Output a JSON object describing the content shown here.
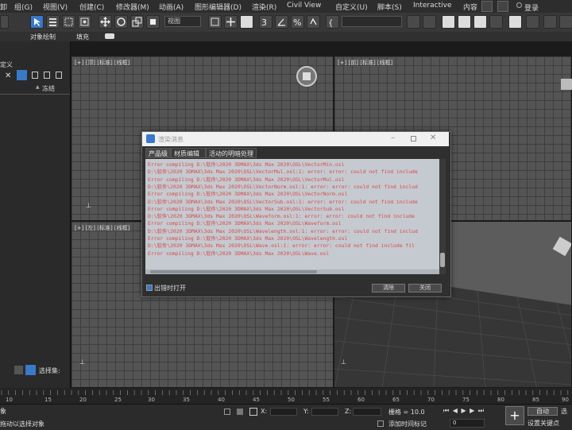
{
  "menubar": {
    "items": [
      "组(G)",
      "视图(V)",
      "创建(C)",
      "修改器(M)",
      "动画(A)",
      "图形编辑器(D)",
      "渲染(R)",
      "Civil View",
      "自定义(U)",
      "脚本(S)",
      "Interactive",
      "内容"
    ],
    "login": "登录",
    "left_fragment": "卸"
  },
  "toolbar": {
    "view_select": "视图"
  },
  "ribbon": {
    "item1": "对象绘制",
    "item2": "填充"
  },
  "left_panel": {
    "title": "定义",
    "freeze_label": "冻结",
    "selection_set": "选择集:"
  },
  "viewports": {
    "top_left": "[+] [顶] [标准] [线框]",
    "top_right": "[+] [前] [标准] [线框]",
    "bottom_left": "[+] [左] [标准] [线框]"
  },
  "dialog": {
    "title": "渲染消息",
    "tabs": [
      "产品级",
      "材质编辑器",
      "活动的明暗处理"
    ],
    "messages": [
      "Error compiling D:\\软件\\2020 3DMAX\\3ds Max 2020\\OSL\\VectorMin.osl",
      "D:\\软件\\2020 3DMAX\\3ds Max 2020\\OSL\\VectorMul.osl:1: error: error: could not find include",
      "Error compiling D:\\软件\\2020 3DMAX\\3ds Max 2020\\OSL\\VectorMul.osl",
      "D:\\软件\\2020 3DMAX\\3ds Max 2020\\OSL\\VectorNorm.osl:1: error: error: could not find includ",
      "Error compiling D:\\软件\\2020 3DMAX\\3ds Max 2020\\OSL\\VectorNorm.osl",
      "D:\\软件\\2020 3DMAX\\3ds Max 2020\\OSL\\VectorSub.osl:1: error: error: could not find include",
      "Error compiling D:\\软件\\2020 3DMAX\\3ds Max 2020\\OSL\\VectorSub.osl",
      "D:\\软件\\2020 3DMAX\\3ds Max 2020\\OSL\\Waveform.osl:1: error: error: could not find include",
      "Error compiling D:\\软件\\2020 3DMAX\\3ds Max 2020\\OSL\\Waveform.osl",
      "D:\\软件\\2020 3DMAX\\3ds Max 2020\\OSL\\Wavelength.osl:1: error: error: could not find includ",
      "Error compiling D:\\软件\\2020 3DMAX\\3ds Max 2020\\OSL\\Wavelength.osl",
      "D:\\软件\\2020 3DMAX\\3ds Max 2020\\OSL\\Wave.osl:1: error: error: could not find include fil",
      "Error compiling D:\\软件\\2020 3DMAX\\3ds Max 2020\\OSL\\Wave.osl"
    ],
    "open_on_error_label": "出错时打开",
    "clear_button": "清除",
    "close_button": "关闭"
  },
  "timeline": {
    "ticks": [
      "10",
      "15",
      "20",
      "25",
      "30",
      "35",
      "40",
      "45",
      "50",
      "55",
      "60",
      "65",
      "70",
      "75",
      "80",
      "85",
      "90"
    ]
  },
  "statusbar": {
    "left_top": "象",
    "left_bottom": "拖动以选择对象",
    "x_label": "X:",
    "y_label": "Y:",
    "z_label": "Z:",
    "grid": "栅格 = 10.0",
    "add_time_tag": "添加时间标记",
    "frame_value": "0",
    "auto_button": "自动",
    "set_key_label": "设置关键点",
    "right_fragment": "选"
  },
  "colors": {
    "accent_blue": "#3a78c8",
    "error_text": "#d84a4a"
  }
}
